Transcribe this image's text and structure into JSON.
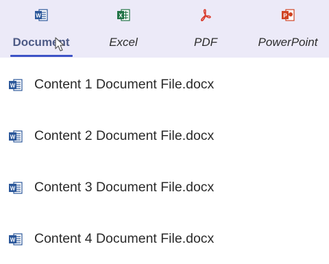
{
  "tabs": [
    {
      "label": "Document",
      "icon": "word-icon",
      "color": "#2b579a",
      "active": true
    },
    {
      "label": "Excel",
      "icon": "excel-icon",
      "color": "#217346",
      "active": false
    },
    {
      "label": "PDF",
      "icon": "pdf-icon",
      "color": "#d93a2b",
      "active": false
    },
    {
      "label": "PowerPoint",
      "icon": "powerpoint-icon",
      "color": "#d04423",
      "active": false
    }
  ],
  "files": [
    {
      "name": "Content 1 Document File.docx",
      "icon": "word-icon"
    },
    {
      "name": "Content 2 Document File.docx",
      "icon": "word-icon"
    },
    {
      "name": "Content 3 Document File.docx",
      "icon": "word-icon"
    },
    {
      "name": "Content 4 Document File.docx",
      "icon": "word-icon"
    }
  ],
  "colors": {
    "tabbar_bg": "#eceaf8",
    "active_text": "#4e5b86",
    "underline": "#3c52c6"
  }
}
